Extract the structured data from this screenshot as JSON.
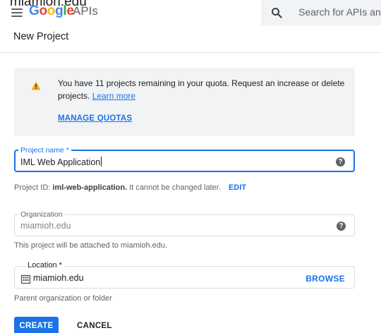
{
  "top_clip_text": "miamioh.edu",
  "appbar": {
    "logo_letters": [
      "G",
      "o",
      "o",
      "g",
      "l",
      "e"
    ],
    "logo_suffix": "APIs",
    "search_placeholder": "Search for APIs and"
  },
  "page": {
    "title": "New Project"
  },
  "notice": {
    "text": "You have 11 projects remaining in your quota. Request an increase or delete projects.",
    "link_label": "Learn more",
    "action_label": "MANAGE QUOTAS"
  },
  "project_name": {
    "label": "Project name *",
    "value": "IML Web Application",
    "id_prefix": "Project ID:",
    "id_value": "iml-web-application.",
    "id_suffix": "It cannot be changed later.",
    "edit_label": "EDIT"
  },
  "organization": {
    "label": "Organization",
    "value": "miamioh.edu",
    "hint": "This project will be attached to miamioh.edu."
  },
  "location": {
    "label": "Location *",
    "value": "miamioh.edu",
    "browse_label": "BROWSE",
    "hint": "Parent organization or folder"
  },
  "actions": {
    "create_label": "CREATE",
    "cancel_label": "CANCEL"
  },
  "icons": {
    "menu": "hamburger-icon",
    "search": "search-icon",
    "warning": "warning-icon",
    "help": "help-icon",
    "building": "building-icon"
  },
  "colors": {
    "accent": "#1a73e8",
    "warning": "#f9ab00",
    "notice_bg": "#f1f3f4",
    "text": "#202124",
    "muted": "#5f6368"
  }
}
